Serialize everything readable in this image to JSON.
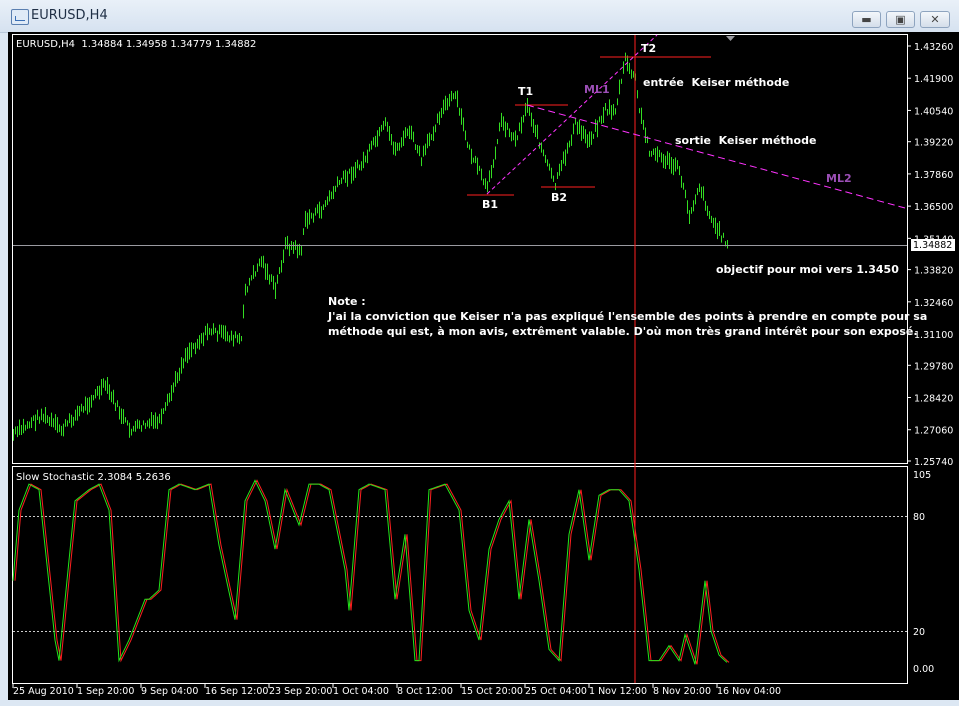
{
  "window": {
    "title": "EURUSD,H4",
    "minimize_icon": "minimize-icon",
    "maximize_icon": "maximize-icon",
    "close_icon": "close-icon"
  },
  "chart_header": "EURUSD,H4  1.34884 1.34958 1.34779 1.34882",
  "price_axis": {
    "ticks": [
      "1.43260",
      "1.41900",
      "1.40540",
      "1.39220",
      "1.37860",
      "1.36500",
      "1.35140",
      "1.33820",
      "1.32460",
      "1.31100",
      "1.29780",
      "1.28420",
      "1.27060",
      "1.25740"
    ],
    "current": "1.34882"
  },
  "time_axis": [
    "25 Aug 2010",
    "1 Sep 20:00",
    "9 Sep 04:00",
    "16 Sep 12:00",
    "23 Sep 20:00",
    "1 Oct 04:00",
    "8 Oct 12:00",
    "15 Oct 20:00",
    "25 Oct 04:00",
    "1 Nov 12:00",
    "8 Nov 20:00",
    "16 Nov 04:00"
  ],
  "indicator": {
    "title": "Slow Stochastic 2.3084 5.2636",
    "ticks": [
      "105",
      "80",
      "20",
      "0.00"
    ],
    "colors": {
      "k": "#22e61a",
      "d": "#ff2020"
    }
  },
  "annotations": {
    "t1": "T1",
    "t2": "T2",
    "b1": "B1",
    "b2": "B2",
    "ml1": "ML1",
    "ml2": "ML2",
    "entree": "entrée  Keiser méthode",
    "sortie": "sortie  Keiser méthode",
    "objectif": "objectif pour moi vers 1.3450",
    "note_title": "Note :",
    "note_line1": "J'ai la conviction que Keiser n'a pas expliqué l'ensemble des points à prendre en compte pour sa",
    "note_line2": "méthode qui est, à mon avis, extrêment valable. D'où mon très grand intérêt pour son exposé."
  },
  "colors": {
    "bars": "#33dd22",
    "levels": "#ff2020",
    "median_lines": "#ff33ff",
    "ml_label": "#9b4fb5"
  },
  "chart_data": {
    "type": "bar",
    "title": "EURUSD,H4",
    "ylim": [
      1.2574,
      1.4326
    ],
    "price_anchors": [
      [
        0,
        1.2684
      ],
      [
        14,
        1.2768
      ],
      [
        24,
        1.2705
      ],
      [
        46,
        1.2895
      ],
      [
        58,
        1.2705
      ],
      [
        74,
        1.2748
      ],
      [
        86,
        1.3022
      ],
      [
        98,
        1.3127
      ],
      [
        114,
        1.3085
      ],
      [
        116,
        1.3296
      ],
      [
        124,
        1.3423
      ],
      [
        131,
        1.3296
      ],
      [
        136,
        1.3486
      ],
      [
        144,
        1.3465
      ],
      [
        146,
        1.3592
      ],
      [
        154,
        1.3634
      ],
      [
        164,
        1.3761
      ],
      [
        174,
        1.3824
      ],
      [
        186,
        1.3993
      ],
      [
        191,
        1.3887
      ],
      [
        198,
        1.3971
      ],
      [
        204,
        1.3845
      ],
      [
        214,
        1.4056
      ],
      [
        221,
        1.4119
      ],
      [
        228,
        1.3887
      ],
      [
        237,
        1.3718
      ],
      [
        244,
        1.4014
      ],
      [
        251,
        1.3929
      ],
      [
        257,
        1.4077
      ],
      [
        266,
        1.3845
      ],
      [
        271,
        1.3739
      ],
      [
        281,
        1.3993
      ],
      [
        288,
        1.3929
      ],
      [
        296,
        1.4056
      ],
      [
        301,
        1.4056
      ],
      [
        306,
        1.4267
      ],
      [
        311,
        1.4182
      ],
      [
        313,
        1.4056
      ],
      [
        318,
        1.3887
      ],
      [
        326,
        1.3845
      ],
      [
        333,
        1.3803
      ],
      [
        338,
        1.3613
      ],
      [
        343,
        1.3739
      ],
      [
        349,
        1.3592
      ],
      [
        357,
        1.3488
      ]
    ],
    "stochastic_anchors": [
      [
        0,
        47
      ],
      [
        3,
        85
      ],
      [
        8,
        99
      ],
      [
        13,
        96
      ],
      [
        21,
        15
      ],
      [
        23,
        4
      ],
      [
        28,
        58
      ],
      [
        31,
        90
      ],
      [
        38,
        96
      ],
      [
        43,
        99
      ],
      [
        48,
        85
      ],
      [
        53,
        4
      ],
      [
        58,
        15
      ],
      [
        66,
        37
      ],
      [
        68,
        37
      ],
      [
        73,
        42
      ],
      [
        78,
        96
      ],
      [
        83,
        99
      ],
      [
        91,
        96
      ],
      [
        98,
        99
      ],
      [
        103,
        66
      ],
      [
        111,
        26
      ],
      [
        116,
        90
      ],
      [
        121,
        101
      ],
      [
        126,
        90
      ],
      [
        131,
        64
      ],
      [
        136,
        96
      ],
      [
        143,
        77
      ],
      [
        148,
        99
      ],
      [
        153,
        99
      ],
      [
        158,
        96
      ],
      [
        166,
        53
      ],
      [
        168,
        31
      ],
      [
        173,
        96
      ],
      [
        178,
        99
      ],
      [
        186,
        96
      ],
      [
        191,
        37
      ],
      [
        196,
        72
      ],
      [
        201,
        4
      ],
      [
        203,
        4
      ],
      [
        208,
        96
      ],
      [
        216,
        99
      ],
      [
        223,
        85
      ],
      [
        228,
        31
      ],
      [
        233,
        15
      ],
      [
        238,
        64
      ],
      [
        243,
        80
      ],
      [
        248,
        90
      ],
      [
        253,
        37
      ],
      [
        258,
        80
      ],
      [
        263,
        47
      ],
      [
        268,
        10
      ],
      [
        273,
        4
      ],
      [
        278,
        72
      ],
      [
        283,
        96
      ],
      [
        288,
        58
      ],
      [
        293,
        93
      ],
      [
        298,
        96
      ],
      [
        303,
        96
      ],
      [
        308,
        90
      ],
      [
        313,
        53
      ],
      [
        318,
        4
      ],
      [
        323,
        4
      ],
      [
        328,
        12
      ],
      [
        333,
        4
      ],
      [
        336,
        18
      ],
      [
        341,
        2
      ],
      [
        346,
        47
      ],
      [
        349,
        20
      ],
      [
        353,
        7
      ],
      [
        357,
        3
      ]
    ],
    "stochastic_levels": [
      80,
      20
    ],
    "stochastic_ylim": [
      0,
      105
    ]
  }
}
